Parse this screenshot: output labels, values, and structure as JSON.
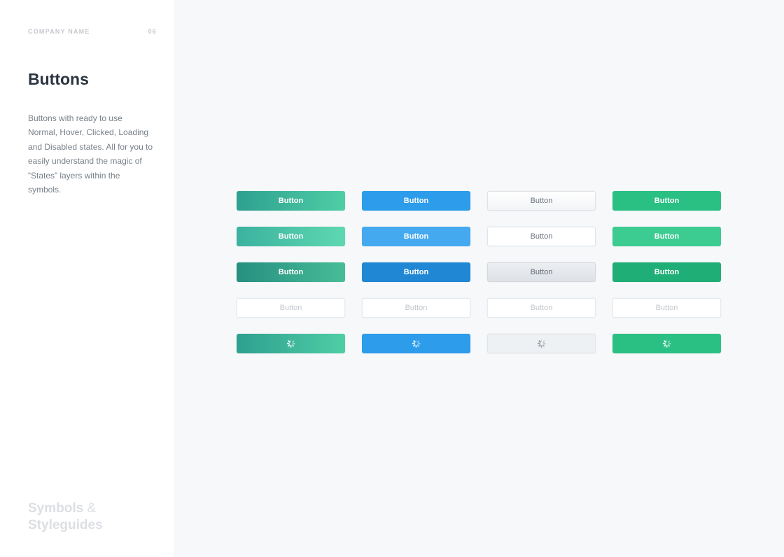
{
  "sidebar": {
    "company": "COMPANY NAME",
    "page_number": "06",
    "title": "Buttons",
    "description": "Buttons with ready to use Normal, Hover, Clicked, Loading and Disabled states. All for you to easily understand the magic of “States” layers within the symbols.",
    "footer_line1": "Symbols",
    "footer_amp": "&",
    "footer_line2": "Styleguides"
  },
  "buttons": {
    "label": "Button",
    "columns": [
      "teal",
      "blue",
      "white",
      "green"
    ],
    "states": [
      "normal",
      "hover",
      "clicked",
      "disabled",
      "loading"
    ]
  }
}
